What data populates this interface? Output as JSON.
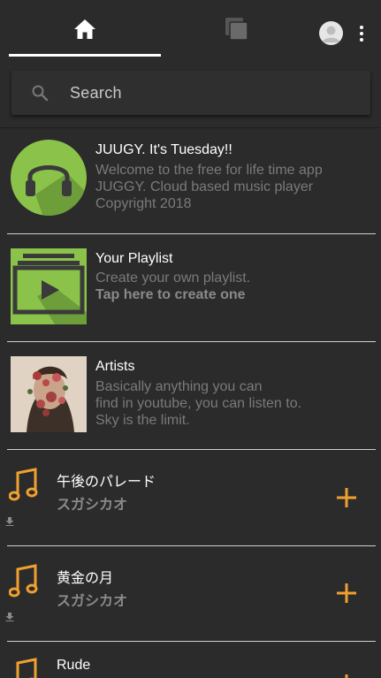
{
  "header": {
    "tabs": [
      {
        "name": "home",
        "active": true
      },
      {
        "name": "pages",
        "active": false
      }
    ]
  },
  "search": {
    "placeholder": "Search"
  },
  "cards": [
    {
      "title": "JUUGY. It's Tuesday!!",
      "lines": [
        "Welcome to the free for life time app",
        "JUGGY. Cloud based music player",
        "Copyright 2018"
      ]
    },
    {
      "title": "Your Playlist",
      "line1": "Create your own playlist.",
      "line2": "Tap here to create one"
    },
    {
      "title": "Artists",
      "lines": [
        "Basically anything you can",
        "find in youtube, you can listen to.",
        "Sky is the limit."
      ]
    }
  ],
  "songs": [
    {
      "title": "午後のパレード",
      "artist": "スガシカオ"
    },
    {
      "title": "黄金の月",
      "artist": "スガシカオ"
    },
    {
      "title": "Rude",
      "artist": ""
    }
  ],
  "colors": {
    "background": "#2b2b2b",
    "accent": "#f0a030",
    "green": "#8bc34a",
    "muted_text": "#7a7a7a"
  }
}
